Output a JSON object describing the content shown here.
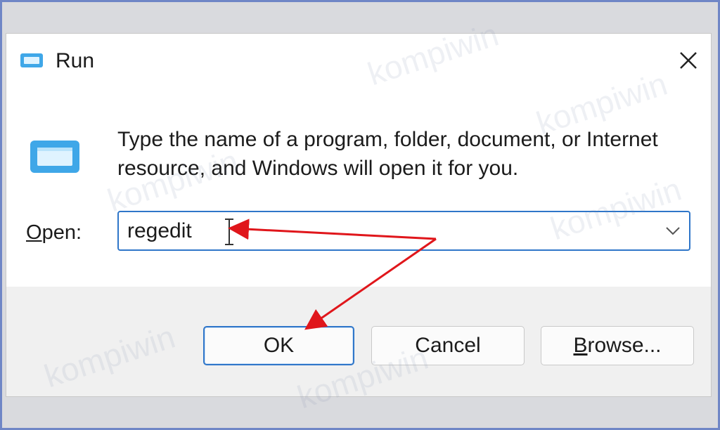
{
  "window": {
    "title": "Run",
    "close_icon": "close-icon"
  },
  "body": {
    "description_line1": "Type the name of a program, folder, document, or Internet",
    "description_line2": "resource, and Windows will open it for you.",
    "icon": "run-icon"
  },
  "open": {
    "label_accel": "O",
    "label_rest": "pen:",
    "value": "regedit"
  },
  "buttons": {
    "ok": "OK",
    "cancel": "Cancel",
    "browse_accel": "B",
    "browse_rest": "rowse..."
  },
  "watermark": "kompiwin",
  "colors": {
    "accent": "#2f76c9",
    "arrow": "#e0161b",
    "frame_border": "#6f86c6"
  }
}
